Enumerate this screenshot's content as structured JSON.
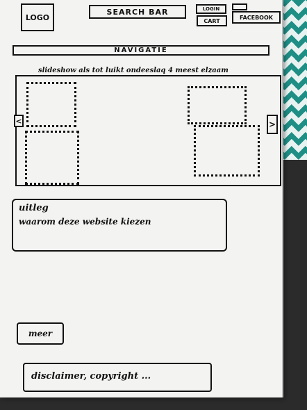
{
  "header": {
    "logo": "LOGO",
    "search": "SEARCH BAR",
    "login": "LOGIN",
    "cart": "CART",
    "facebook": "FACEBOOK"
  },
  "nav": {
    "label": "NAVIGATIE"
  },
  "slideshow": {
    "caption": "slideshow als tot luikt ondeeslaq 4 meest elzaam",
    "prev_icon": "<",
    "next_icon": ">"
  },
  "info": {
    "title": "uitleg",
    "text": "waarom deze website kiezen"
  },
  "buttons": {
    "more": "meer"
  },
  "footer": {
    "text": "disclaimer, copyright ..."
  }
}
